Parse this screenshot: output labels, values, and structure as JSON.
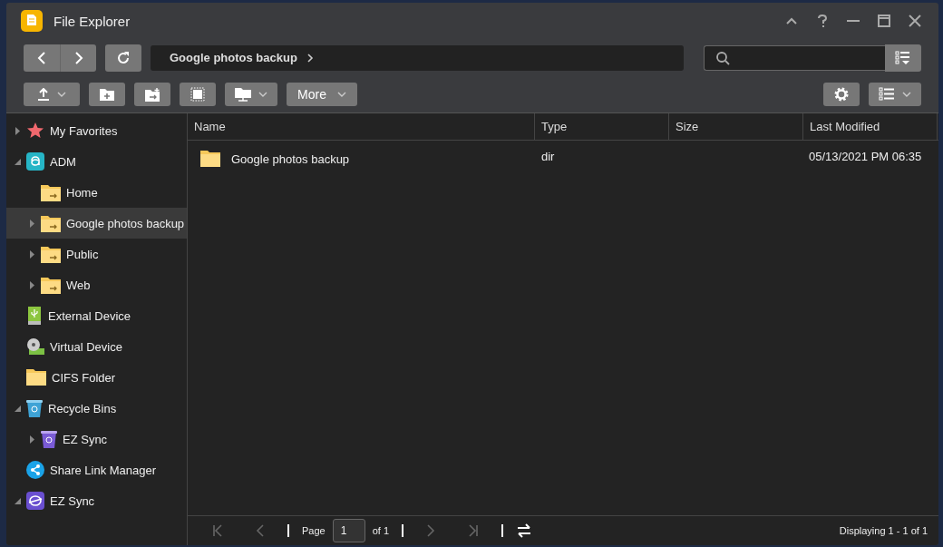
{
  "window": {
    "title": "File Explorer"
  },
  "path": {
    "crumbs": [
      "Google photos backup"
    ]
  },
  "toolbar": {
    "more_label": "More"
  },
  "sidebar": {
    "items": [
      {
        "label": "My Favorites",
        "kind": "star",
        "expanded": false,
        "selected": false
      },
      {
        "label": "ADM",
        "kind": "adm",
        "expanded": true,
        "selected": false,
        "children": [
          {
            "label": "Home",
            "kind": "share-folder",
            "selected": false
          },
          {
            "label": "Google photos backup",
            "kind": "share-folder",
            "expanded": false,
            "selected": true
          },
          {
            "label": "Public",
            "kind": "share-folder",
            "expanded": false,
            "selected": false
          },
          {
            "label": "Web",
            "kind": "share-folder",
            "expanded": false,
            "selected": false
          }
        ]
      },
      {
        "label": "External Device",
        "kind": "usb",
        "selected": false
      },
      {
        "label": "Virtual Device",
        "kind": "disc",
        "selected": false
      },
      {
        "label": "CIFS Folder",
        "kind": "folder",
        "selected": false
      },
      {
        "label": "Recycle Bins",
        "kind": "recycle",
        "expanded": true,
        "selected": false,
        "children": [
          {
            "label": "EZ Sync",
            "kind": "recycle-purple",
            "expanded": false,
            "selected": false
          }
        ]
      },
      {
        "label": "Share Link Manager",
        "kind": "share",
        "selected": false
      },
      {
        "label": "EZ Sync",
        "kind": "ezsync",
        "expanded": true,
        "selected": false
      }
    ]
  },
  "table": {
    "columns": [
      "Name",
      "Type",
      "Size",
      "Last Modified"
    ],
    "rows": [
      {
        "name": "Google photos backup",
        "type": "dir",
        "modified": "05/13/2021 PM 06:35",
        "selected": false
      }
    ]
  },
  "pager": {
    "page_label": "Page",
    "page": "1",
    "of": "of 1",
    "first_disabled": true,
    "prev_disabled": true,
    "next_disabled": true,
    "last_disabled": true,
    "summary": "Displaying 1 - 1 of 1"
  }
}
